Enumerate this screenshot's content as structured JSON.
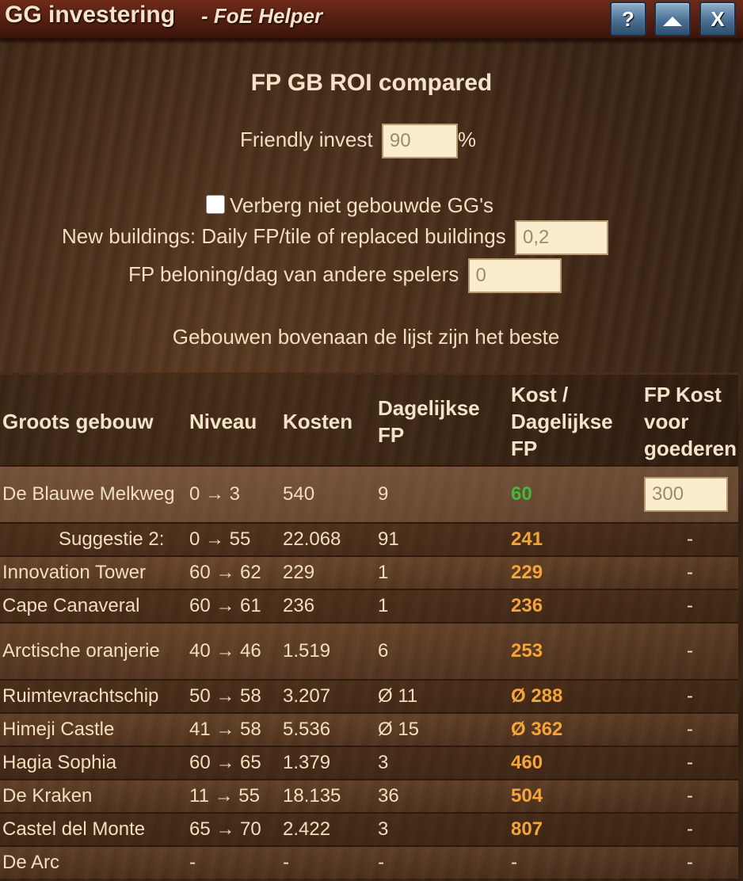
{
  "window": {
    "title": "GG investering",
    "subtitle": "- FoE Helper",
    "buttons": {
      "help": "?",
      "close": "X"
    }
  },
  "heading": "FP GB ROI compared",
  "friendly_invest": {
    "label": "Friendly invest",
    "value": "90",
    "unit": "%"
  },
  "hide_unbuilt": {
    "label": "Verberg niet gebouwde GG's",
    "checked": false
  },
  "new_buildings": {
    "label": "New buildings: Daily FP/tile of replaced buildings",
    "value": "0,2"
  },
  "fp_reward": {
    "label": "FP beloning/dag van andere spelers",
    "value": "0"
  },
  "hint": "Gebouwen bovenaan de lijst zijn het beste",
  "table": {
    "headers": {
      "building": "Groots gebouw",
      "level": "Niveau",
      "cost": "Kosten",
      "daily_fp_1": "Dagelijkse",
      "daily_fp_2": "FP",
      "ratio_1": "Kost /",
      "ratio_2": "Dagelijkse",
      "ratio_3": "FP",
      "goods_1": "FP Kost",
      "goods_2": "voor",
      "goods_3": "goederen"
    },
    "rows": [
      {
        "name": "De Blauwe Melkweg",
        "level": "0 → 3",
        "cost": "540",
        "daily": "9",
        "ratio": "60",
        "goods": "300"
      },
      {
        "name": "Suggestie 2:",
        "level": "0 → 55",
        "cost": "22.068",
        "daily": "91",
        "ratio": "241",
        "goods": "-"
      },
      {
        "name": "Innovation Tower",
        "level": "60 → 62",
        "cost": "229",
        "daily": "1",
        "ratio": "229",
        "goods": "-"
      },
      {
        "name": "Cape Canaveral",
        "level": "60 → 61",
        "cost": "236",
        "daily": "1",
        "ratio": "236",
        "goods": "-"
      },
      {
        "name": "Arctische oranjerie",
        "level": "40 → 46",
        "cost": "1.519",
        "daily": "6",
        "ratio": "253",
        "goods": "-"
      },
      {
        "name": "Ruimtevrachtschip",
        "level": "50 → 58",
        "cost": "3.207",
        "daily": "Ø 11",
        "ratio": "Ø 288",
        "goods": "-"
      },
      {
        "name": "Himeji Castle",
        "level": "41 → 58",
        "cost": "5.536",
        "daily": "Ø 15",
        "ratio": "Ø 362",
        "goods": "-"
      },
      {
        "name": "Hagia Sophia",
        "level": "60 → 65",
        "cost": "1.379",
        "daily": "3",
        "ratio": "460",
        "goods": "-"
      },
      {
        "name": "De Kraken",
        "level": "11 → 55",
        "cost": "18.135",
        "daily": "36",
        "ratio": "504",
        "goods": "-"
      },
      {
        "name": "Castel del Monte",
        "level": "65 → 70",
        "cost": "2.422",
        "daily": "3",
        "ratio": "807",
        "goods": "-"
      },
      {
        "name": "De Arc",
        "level": "-",
        "cost": "-",
        "daily": "-",
        "ratio": "-",
        "goods": "-"
      }
    ]
  },
  "colors": {
    "ratio_best": "#43b83a",
    "ratio_other": "#f5a43a",
    "titlebar": "#5a2214"
  }
}
